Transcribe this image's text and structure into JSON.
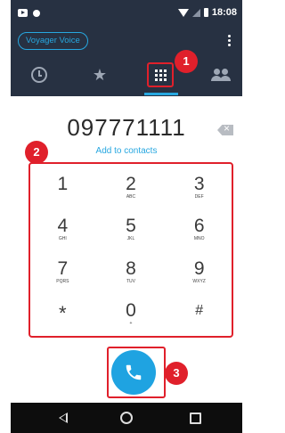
{
  "status_bar": {
    "time": "18:08",
    "icons": [
      "notification-box-icon",
      "dot-icon",
      "wifi-icon",
      "signal-icon",
      "battery-icon"
    ]
  },
  "app_bar": {
    "account_chip": "Voyager Voice",
    "menu_icon": "overflow-menu-icon"
  },
  "tabs": [
    {
      "name": "history",
      "icon": "history-icon",
      "selected": false
    },
    {
      "name": "favorites",
      "icon": "star-icon",
      "selected": false
    },
    {
      "name": "keypad",
      "icon": "keypad-icon",
      "selected": true
    },
    {
      "name": "contacts",
      "icon": "contacts-icon",
      "selected": false
    }
  ],
  "dialer": {
    "number": "097771111",
    "add_to_contacts": "Add to contacts",
    "backspace_icon": "backspace-icon"
  },
  "keypad": [
    {
      "digit": "1",
      "letters": ""
    },
    {
      "digit": "2",
      "letters": "ABC"
    },
    {
      "digit": "3",
      "letters": "DEF"
    },
    {
      "digit": "4",
      "letters": "GHI"
    },
    {
      "digit": "5",
      "letters": "JKL"
    },
    {
      "digit": "6",
      "letters": "MNO"
    },
    {
      "digit": "7",
      "letters": "PQRS"
    },
    {
      "digit": "8",
      "letters": "TUV"
    },
    {
      "digit": "9",
      "letters": "WXYZ"
    },
    {
      "digit": "*",
      "letters": ""
    },
    {
      "digit": "0",
      "letters": "+"
    },
    {
      "digit": "#",
      "letters": ""
    }
  ],
  "annotations": {
    "badge_1": "1",
    "badge_2": "2",
    "badge_3": "3"
  },
  "colors": {
    "header_bg": "#273142",
    "accent": "#1fa3e1",
    "annotation_red": "#e0202b"
  },
  "nav_bar": {
    "icons": [
      "back-icon",
      "home-icon",
      "recent-apps-icon"
    ]
  }
}
